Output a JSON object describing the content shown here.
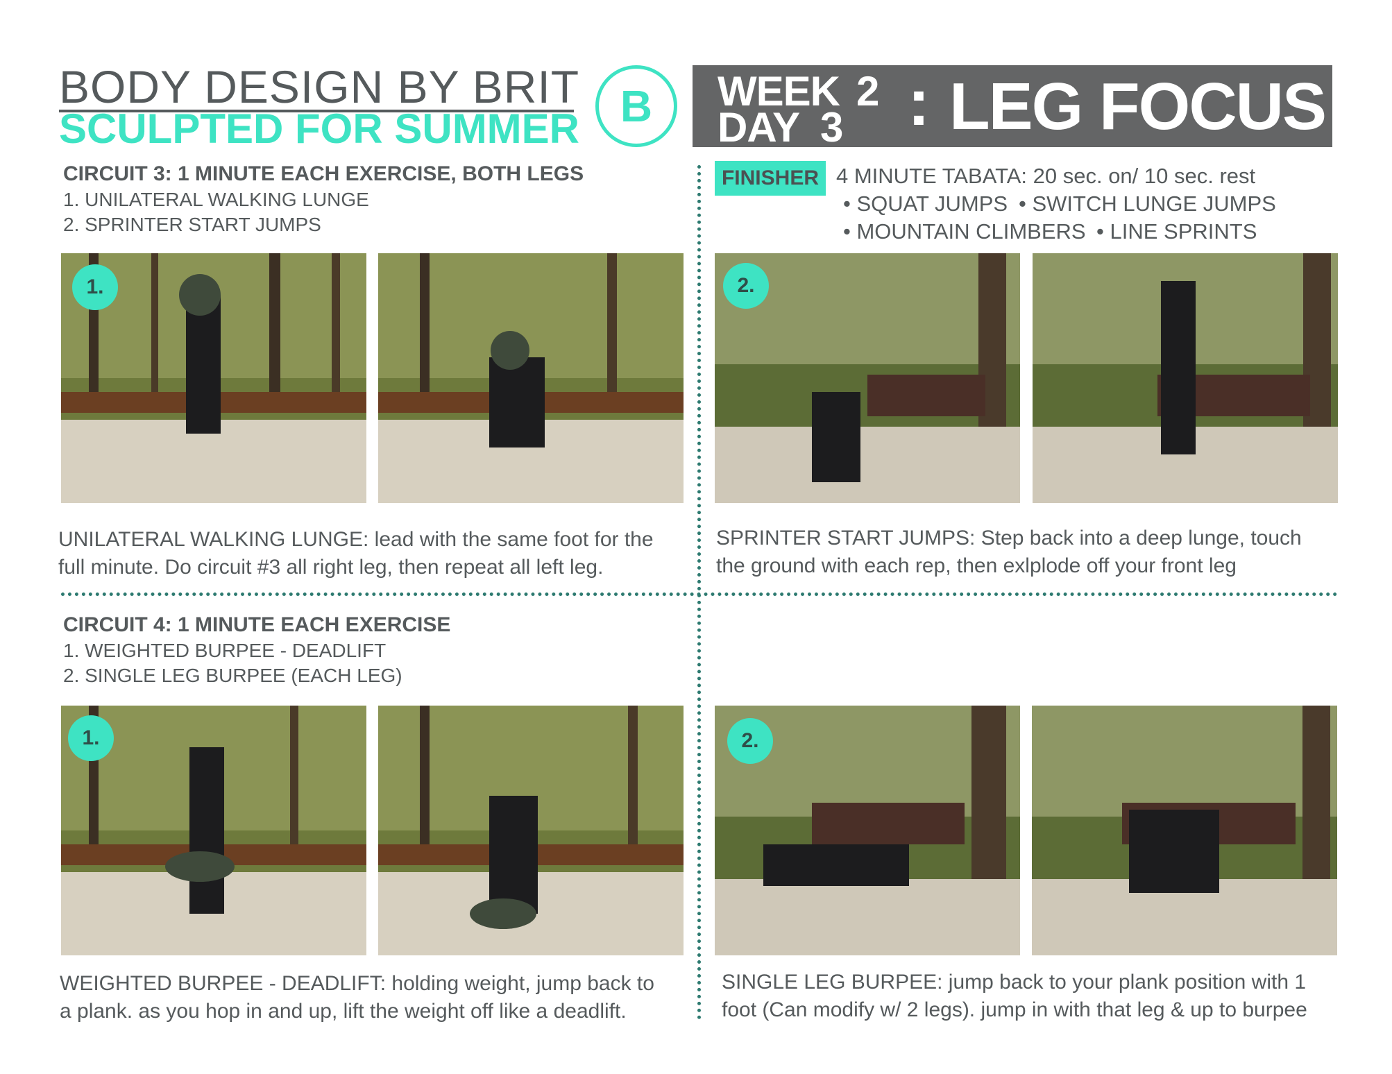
{
  "header": {
    "brand_line1": "BODY DESIGN BY BRIT",
    "brand_line2": "SCULPTED FOR SUMMER",
    "logo_letter": "B",
    "week_label": "WEEK",
    "week_number": "2",
    "day_label": "DAY",
    "day_number": "3",
    "colon": ":",
    "focus_title": "LEG FOCUS"
  },
  "circuit3": {
    "title": "CIRCUIT 3: 1 MINUTE EACH EXERCISE, BOTH LEGS",
    "items": [
      "1. UNILATERAL WALKING LUNGE",
      "2. SPRINTER START JUMPS"
    ],
    "badge_1": "1.",
    "desc_line1": "UNILATERAL WALKING LUNGE: lead with the same foot for the",
    "desc_line2": "full minute. Do circuit #3 all right leg, then repeat all left leg."
  },
  "finisher": {
    "tag": "FINISHER",
    "text": "4 MINUTE TABATA: 20 sec. on/ 10 sec. rest",
    "bullets": [
      "SQUAT JUMPS",
      "SWITCH LUNGE JUMPS",
      "MOUNTAIN CLIMBERS",
      "LINE SPRINTS"
    ],
    "bullet_glyph": "•",
    "badge_2": "2.",
    "desc_line1": "SPRINTER START JUMPS: Step back into a deep lunge, touch",
    "desc_line2": "the ground with each rep, then exlplode off your front leg"
  },
  "circuit4": {
    "title": "CIRCUIT 4: 1 MINUTE EACH EXERCISE",
    "items": [
      "1. WEIGHTED BURPEE - DEADLIFT",
      "2. SINGLE LEG BURPEE (EACH LEG)"
    ],
    "badge_1": "1.",
    "badge_2": "2.",
    "desc1_line1": "WEIGHTED BURPEE - DEADLIFT: holding weight, jump back to",
    "desc1_line2": "a plank. as you hop in and up, lift the weight off like a deadlift.",
    "desc2_line1": "SINGLE LEG BURPEE: jump back to your plank position with 1",
    "desc2_line2": "foot (Can modify w/ 2 legs). jump in with that leg & up to burpee"
  },
  "colors": {
    "accent": "#3ee3c3",
    "banner": "#646566",
    "text": "#555a5c",
    "rule": "#2d7a70"
  }
}
